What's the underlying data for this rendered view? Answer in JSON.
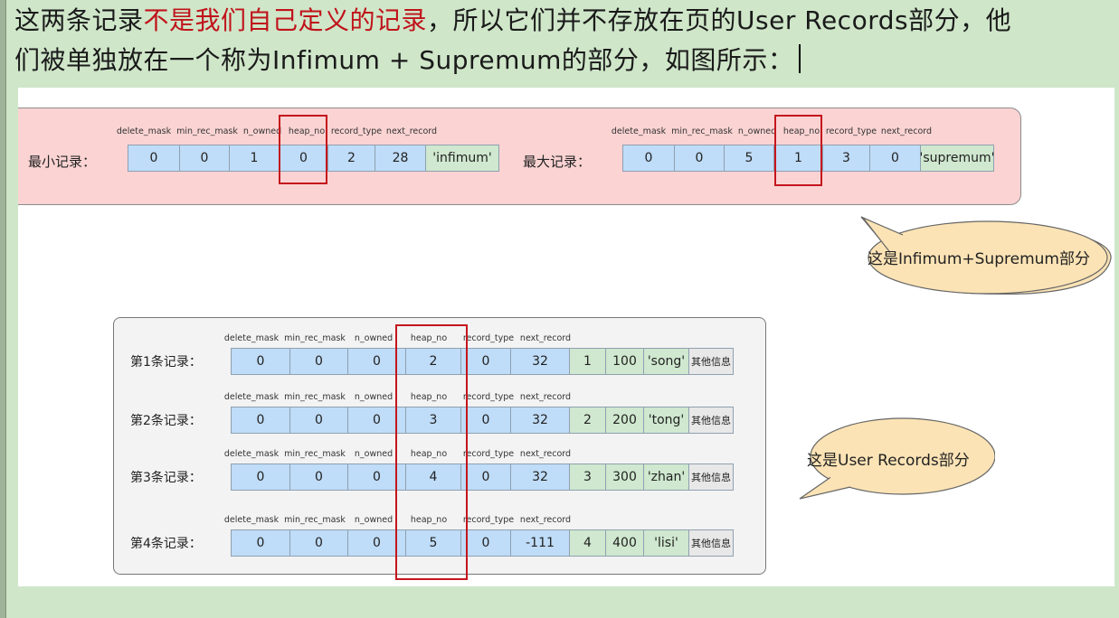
{
  "text": {
    "line1": {
      "pre": "这两条记录",
      "red": "不是我们自己定义的记录",
      "post": "，所以它们并不存放在页的User Records部分，他"
    },
    "line2": "们被单独放在一个称为Infimum + Supremum的部分，如图所示："
  },
  "columns": [
    "delete_mask",
    "min_rec_mask",
    "n_owned",
    "heap_no",
    "record_type",
    "next_record"
  ],
  "infimum": {
    "label": "最小记录：",
    "values": [
      "0",
      "0",
      "1",
      "0",
      "2",
      "28"
    ],
    "name": "'infimum'"
  },
  "supremum": {
    "label": "最大记录：",
    "values": [
      "0",
      "0",
      "5",
      "1",
      "3",
      "0"
    ],
    "name": "'supremum'"
  },
  "user_records": [
    {
      "label": "第1条记录：",
      "values": [
        "0",
        "0",
        "0",
        "2",
        "0",
        "32"
      ],
      "extra": [
        "1",
        "100",
        "'song'"
      ],
      "other": "其他信息"
    },
    {
      "label": "第2条记录：",
      "values": [
        "0",
        "0",
        "0",
        "3",
        "0",
        "32"
      ],
      "extra": [
        "2",
        "200",
        "'tong'"
      ],
      "other": "其他信息"
    },
    {
      "label": "第3条记录：",
      "values": [
        "0",
        "0",
        "0",
        "4",
        "0",
        "32"
      ],
      "extra": [
        "3",
        "300",
        "'zhan'"
      ],
      "other": "其他信息"
    },
    {
      "label": "第4条记录：",
      "values": [
        "0",
        "0",
        "0",
        "5",
        "0",
        "-111"
      ],
      "extra": [
        "4",
        "400",
        "'lisi'"
      ],
      "other": "其他信息"
    }
  ],
  "callouts": {
    "system": "这是Infimum+Supremum部分",
    "user": "这是User Records部分"
  },
  "colors": {
    "page_bg": "#cfe6c9",
    "pink_panel": "#fbd3d3",
    "field_cell": "#bfdcf8",
    "name_cell": "#cfe8cf",
    "highlight": "#c4161c",
    "bubble": "#fbe3b5"
  }
}
